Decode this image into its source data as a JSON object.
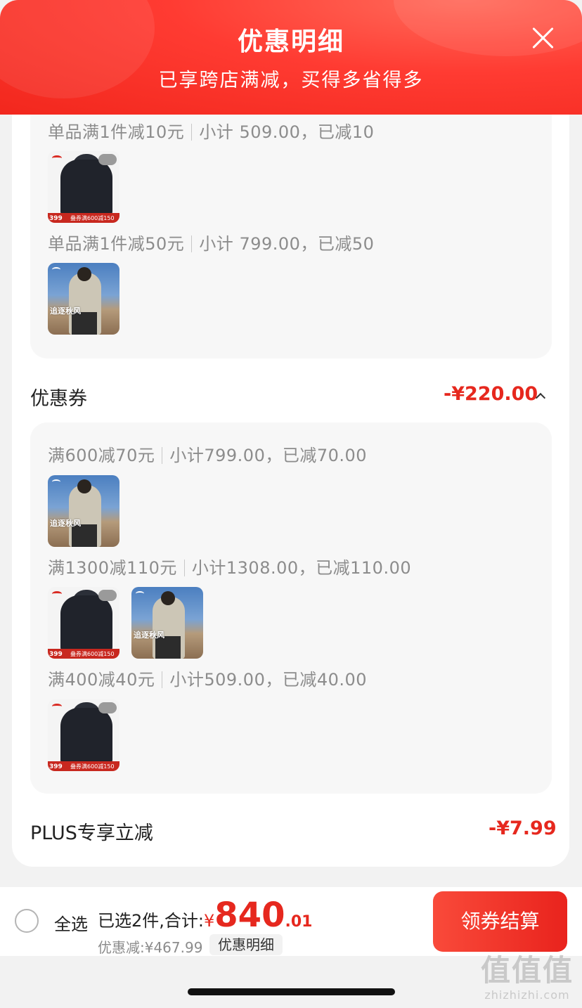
{
  "header": {
    "title": "优惠明细",
    "subtitle": "已享跨店满减，买得多省得多",
    "close_icon": "close-icon"
  },
  "store_discounts": [
    {
      "rule": "单品满1件减10元",
      "subtotal": "小计 509.00，已减10",
      "thumbs": [
        "jacket"
      ]
    },
    {
      "rule": "单品满1件减50元",
      "subtotal": "小计 799.00，已减50",
      "thumbs": [
        "photo"
      ]
    }
  ],
  "coupons": {
    "title": "优惠券",
    "amount": "-¥220.00",
    "items": [
      {
        "rule": "满600减70元",
        "subtotal": "小计799.00，已减70.00",
        "thumbs": [
          "photo"
        ]
      },
      {
        "rule": "满1300减110元",
        "subtotal": "小计1308.00，已减110.00",
        "thumbs": [
          "jacket",
          "photo"
        ]
      },
      {
        "rule": "满400减40元",
        "subtotal": "小计509.00，已减40.00",
        "thumbs": [
          "jacket"
        ]
      }
    ]
  },
  "plus": {
    "title": "PLUS专享立减",
    "amount": "-¥7.99"
  },
  "thumb_text": {
    "jacket_price": "399",
    "jacket_promo": "叠券满600减150",
    "photo_caption": "追逐秋风"
  },
  "footer": {
    "select_all": "全选",
    "selected_label": "已选2件,合计:",
    "currency": "¥",
    "total_int": "840",
    "total_dec": ".01",
    "discount": "优惠减:¥467.99",
    "detail_chip": "优惠明细",
    "checkout": "领券结算"
  },
  "watermark": {
    "big": "值值值",
    "small": "zhizhizhi.com"
  },
  "colors": {
    "accent": "#e6281e",
    "header_red": "#f2271d"
  }
}
